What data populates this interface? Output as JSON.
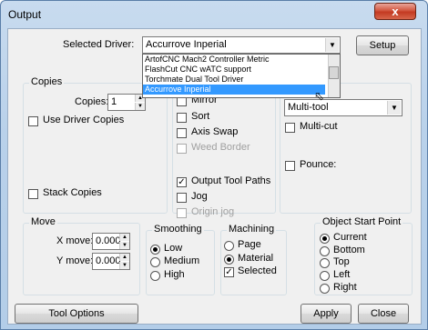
{
  "window": {
    "title": "Output",
    "close_glyph": "x"
  },
  "driver": {
    "label": "Selected Driver:",
    "value": "Accurrove Inperial",
    "setup_button": "Setup",
    "dropdown_items": [
      "ArtofCNC Mach2 Controller Metric",
      "FlashCut CNC wATC support",
      "Torchmate Dual Tool Driver",
      "Accurrove Inperial"
    ]
  },
  "copies": {
    "group_title": "Copies",
    "copies_label": "Copies:",
    "copies_value": "1",
    "use_driver_copies": "Use Driver Copies",
    "stack_copies": "Stack Copies"
  },
  "options": {
    "mirror": "Mirror",
    "sort": "Sort",
    "axis_swap": "Axis Swap",
    "weed_border": "Weed Border",
    "output_tool_paths": "Output Tool Paths",
    "jog": "Jog",
    "origin_jog": "Origin jog"
  },
  "tool": {
    "value": "Multi-tool",
    "multi_cut": "Multi-cut",
    "pounce": "Pounce:"
  },
  "move": {
    "group_title": "Move",
    "x_label": "X move:",
    "x_value": "0.000",
    "y_label": "Y move:",
    "y_value": "0.000"
  },
  "smoothing": {
    "group_title": "Smoothing",
    "low": "Low",
    "medium": "Medium",
    "high": "High"
  },
  "machining": {
    "group_title": "Machining",
    "page": "Page",
    "material": "Material",
    "selected": "Selected"
  },
  "start_point": {
    "group_title": "Object Start Point",
    "current": "Current",
    "bottom": "Bottom",
    "top": "Top",
    "left": "Left",
    "right": "Right"
  },
  "footer": {
    "tool_options": "Tool Options",
    "apply": "Apply",
    "close": "Close"
  }
}
